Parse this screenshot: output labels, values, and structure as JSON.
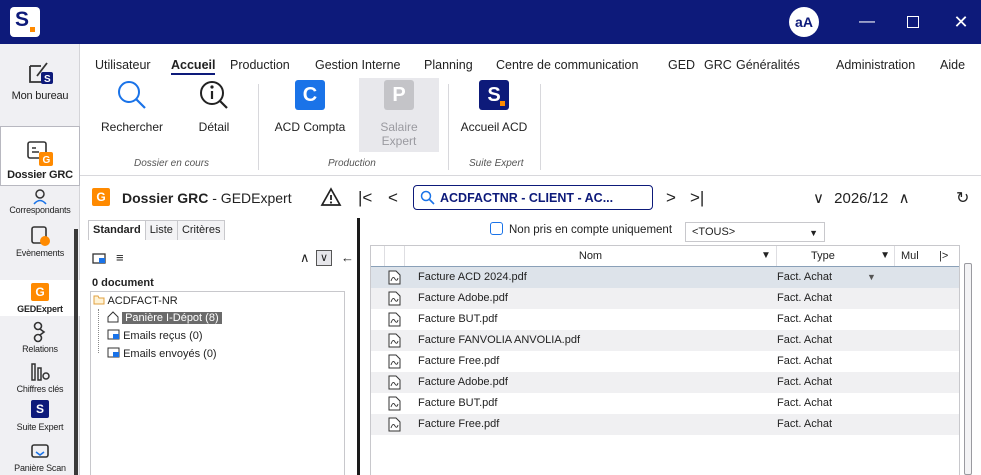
{
  "titlebar": {
    "avatar": "aA",
    "logo_letter": "S"
  },
  "rail": [
    {
      "label": "Mon bureau",
      "icon": "desk-icon",
      "letter": "S"
    },
    {
      "label": "Dossier GRC",
      "icon": "dossier-icon",
      "letter": "G"
    },
    {
      "label": "Correspondants",
      "icon": "contacts-icon"
    },
    {
      "label": "Evènements",
      "icon": "events-icon"
    },
    {
      "label": "GEDExpert",
      "icon": "ged-icon",
      "letter": "G"
    },
    {
      "label": "Relations",
      "icon": "relations-icon"
    },
    {
      "label": "Chiffres clés",
      "icon": "chart-icon"
    },
    {
      "label": "Suite Expert",
      "icon": "suite-icon",
      "letter": "S"
    },
    {
      "label": "Panière Scan",
      "icon": "scan-icon"
    }
  ],
  "menu": [
    "Utilisateur",
    "Accueil",
    "Production",
    "Gestion Interne",
    "Planning",
    "Centre de communication",
    "GED",
    "GRC",
    "Généralités",
    "Administration",
    "Aide"
  ],
  "ribbon": {
    "rechercher": "Rechercher",
    "detail": "Détail",
    "acd_compta": "ACD Compta",
    "acd_letter": "C",
    "salaire_line1": "Salaire",
    "salaire_line2": "Expert",
    "salaire_letter": "P",
    "accueil_acd": "Accueil ACD",
    "accueil_letter": "S",
    "group_dossier": "Dossier en cours",
    "group_production": "Production",
    "group_suite": "Suite Expert"
  },
  "header": {
    "badge": "G",
    "title_bold": "Dossier GRC",
    "title_rest": " - GEDExpert",
    "search_text": "ACDFACTNR  - CLIENT - AC...",
    "period": "2026/12"
  },
  "left": {
    "tabs": [
      "Standard",
      "Liste",
      "Critères"
    ],
    "doc_count": "0 document",
    "root": "ACDFACT-NR",
    "nodes": [
      "Panière I-Dépot (8)",
      "Emails reçus (0)",
      "Emails envoyés (0)"
    ]
  },
  "right": {
    "filter_label": "Non pris en compte uniquement",
    "filter_select": "<TOUS>",
    "columns": {
      "nom": "Nom",
      "type": "Type",
      "mul": "Mul"
    },
    "rows": [
      {
        "nom": "Facture ACD 2024.pdf",
        "type": "Fact. Achat"
      },
      {
        "nom": "Facture Adobe.pdf",
        "type": "Fact. Achat"
      },
      {
        "nom": "Facture BUT.pdf",
        "type": "Fact. Achat"
      },
      {
        "nom": "Facture FANVOLIA ANVOLIA.pdf",
        "type": "Fact. Achat"
      },
      {
        "nom": "Facture Free.pdf",
        "type": "Fact. Achat"
      },
      {
        "nom": "Facture Adobe.pdf",
        "type": "Fact. Achat"
      },
      {
        "nom": "Facture BUT.pdf",
        "type": "Fact. Achat"
      },
      {
        "nom": "Facture Free.pdf",
        "type": "Fact. Achat"
      }
    ]
  }
}
